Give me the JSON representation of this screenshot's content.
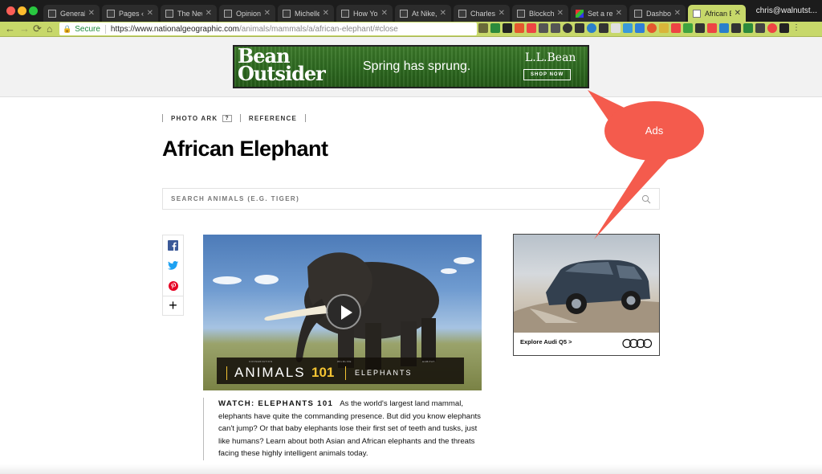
{
  "browser": {
    "tabs": [
      {
        "title": "General Se",
        "icon": "page-icon"
      },
      {
        "title": "Pages ‹ chr",
        "icon": "page-icon"
      },
      {
        "title": "The New Yo",
        "icon": "page-icon"
      },
      {
        "title": "Opinion | A",
        "icon": "page-icon"
      },
      {
        "title": "Michelle W",
        "icon": "page-icon"
      },
      {
        "title": "How Your B",
        "icon": "page-icon"
      },
      {
        "title": "At Nike, Re",
        "icon": "page-icon"
      },
      {
        "title": "Charles Ne",
        "icon": "page-icon"
      },
      {
        "title": "Blockchain",
        "icon": "page-icon"
      },
      {
        "title": "Set a remin",
        "icon": "colorful-icon"
      },
      {
        "title": "Dashboard",
        "icon": "page-icon"
      },
      {
        "title": "African Elep",
        "icon": "natgeo-icon",
        "active": true
      }
    ],
    "profile": "chris@walnutst...",
    "secure_label": "Secure",
    "url_host": "https://www.nationalgeographic.com",
    "url_path": "/animals/mammals/a/african-elephant/#close",
    "accent_color": "#c7d86a"
  },
  "banner_ad": {
    "brand_line1": "Bean",
    "brand_line2": "Outsider",
    "tagline": "Spring has sprung.",
    "logo": "L.L.Bean",
    "cta": "SHOP NOW"
  },
  "page": {
    "breadcrumbs": [
      {
        "label": "PHOTO ARK",
        "help": "?"
      },
      {
        "label": "REFERENCE"
      }
    ],
    "title": "African Elephant",
    "search": {
      "placeholder": "SEARCH ANIMALS (E.G. TIGER)"
    },
    "share_buttons": [
      "facebook-icon",
      "twitter-icon",
      "pinterest-icon",
      "plus-icon"
    ],
    "video": {
      "band_small_1": "CONSERVATION",
      "band_small_2": "WILDLIFE",
      "band_small_3": "HABITAT",
      "series": "ANIMALS",
      "number": "101",
      "topic": "ELEPHANTS"
    },
    "caption": {
      "heading": "WATCH: ELEPHANTS 101",
      "body": "As the world's largest land mammal, elephants have quite the commanding presence. But did you know elephants can't jump? Or that baby elephants lose their first set of teeth and tusks, just like humans? Learn about both Asian and African elephants and the threats facing these highly intelligent animals today."
    }
  },
  "side_ad": {
    "text": "Explore Audi Q5 >"
  },
  "annotation": {
    "label": "Ads",
    "color": "#f45b4d"
  }
}
